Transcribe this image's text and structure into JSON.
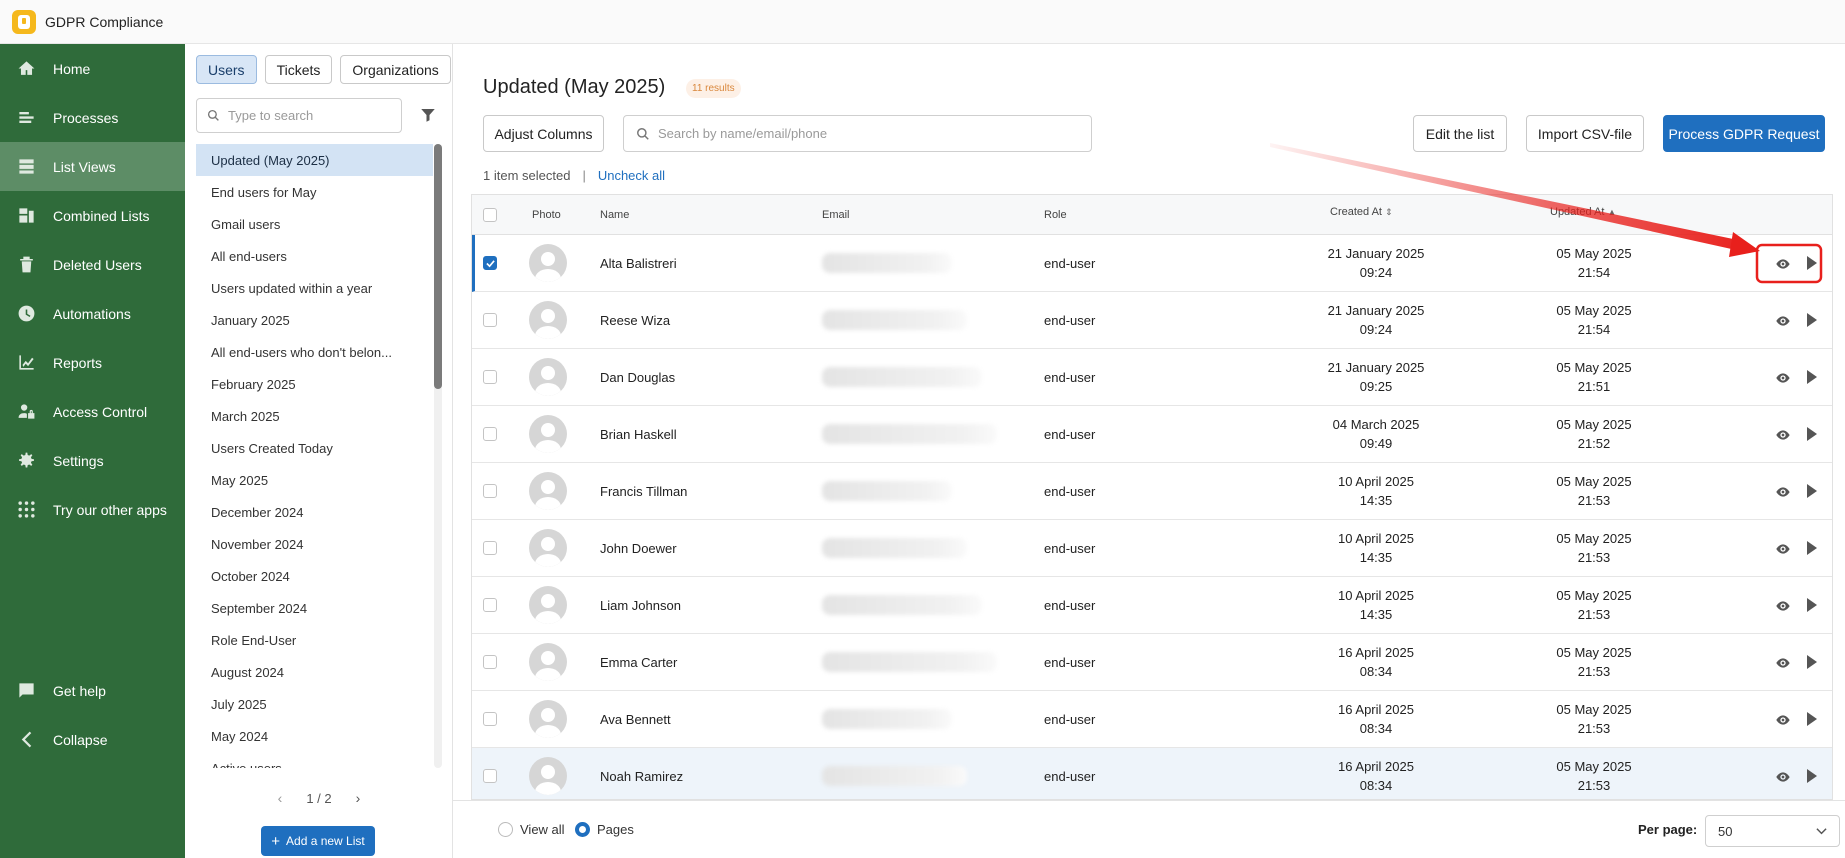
{
  "app": {
    "title": "GDPR Compliance"
  },
  "sidebar": {
    "items": [
      {
        "label": "Home",
        "icon": "home-icon"
      },
      {
        "label": "Processes",
        "icon": "processes-icon"
      },
      {
        "label": "List Views",
        "icon": "list-views-icon",
        "active": true
      },
      {
        "label": "Combined Lists",
        "icon": "combined-lists-icon"
      },
      {
        "label": "Deleted Users",
        "icon": "deleted-users-icon"
      },
      {
        "label": "Automations",
        "icon": "clock-icon"
      },
      {
        "label": "Reports",
        "icon": "chart-icon"
      },
      {
        "label": "Access Control",
        "icon": "user-lock-icon"
      },
      {
        "label": "Settings",
        "icon": "gear-icon"
      },
      {
        "label": "Try our other apps",
        "icon": "grid-icon"
      }
    ],
    "bottom": [
      {
        "label": "Get help",
        "icon": "chat-icon"
      },
      {
        "label": "Collapse",
        "icon": "chevron-left-icon"
      }
    ]
  },
  "listpanel": {
    "tabs": [
      "Users",
      "Tickets",
      "Organizations"
    ],
    "search_placeholder": "Type to search",
    "lists": [
      "Updated (May 2025)",
      "End users for May",
      "Gmail users",
      "All end-users",
      "Users updated within a year",
      "January 2025",
      "All end-users who don't belon...",
      "February 2025",
      "March 2025",
      "Users Created Today",
      "May 2025",
      "December 2024",
      "November 2024",
      "October 2024",
      "September 2024",
      "Role End-User",
      "August 2024",
      "July 2025",
      "May 2024",
      "Active users"
    ],
    "pagination": "1 / 2",
    "add_button": "Add a new List"
  },
  "main": {
    "title": "Updated (May 2025)",
    "count": "11 results",
    "adjust_columns": "Adjust Columns",
    "search_placeholder": "Search by name/email/phone",
    "edit_list": "Edit the list",
    "import_csv": "Import CSV-file",
    "process_gdpr": "Process GDPR Request",
    "selection_text": "1 item selected",
    "separator": "|",
    "uncheck_all": "Uncheck all",
    "columns": {
      "photo": "Photo",
      "name": "Name",
      "email": "Email",
      "role": "Role",
      "created": "Created At",
      "updated": "Updated At"
    },
    "rows": [
      {
        "name": "Alta Balistreri",
        "role": "end-user",
        "created_date": "21 January 2025",
        "created_time": "09:24",
        "updated_date": "05 May 2025",
        "updated_time": "21:54",
        "checked": true
      },
      {
        "name": "Reese Wiza",
        "role": "end-user",
        "created_date": "21 January 2025",
        "created_time": "09:24",
        "updated_date": "05 May 2025",
        "updated_time": "21:54"
      },
      {
        "name": "Dan Douglas",
        "role": "end-user",
        "created_date": "21 January 2025",
        "created_time": "09:25",
        "updated_date": "05 May 2025",
        "updated_time": "21:51"
      },
      {
        "name": "Brian Haskell",
        "role": "end-user",
        "created_date": "04 March 2025",
        "created_time": "09:49",
        "updated_date": "05 May 2025",
        "updated_time": "21:52"
      },
      {
        "name": "Francis Tillman",
        "role": "end-user",
        "created_date": "10 April 2025",
        "created_time": "14:35",
        "updated_date": "05 May 2025",
        "updated_time": "21:53"
      },
      {
        "name": "John Doewer",
        "role": "end-user",
        "created_date": "10 April 2025",
        "created_time": "14:35",
        "updated_date": "05 May 2025",
        "updated_time": "21:53"
      },
      {
        "name": "Liam Johnson",
        "role": "end-user",
        "created_date": "10 April 2025",
        "created_time": "14:35",
        "updated_date": "05 May 2025",
        "updated_time": "21:53"
      },
      {
        "name": "Emma Carter",
        "role": "end-user",
        "created_date": "16 April 2025",
        "created_time": "08:34",
        "updated_date": "05 May 2025",
        "updated_time": "21:53"
      },
      {
        "name": "Ava Bennett",
        "role": "end-user",
        "created_date": "16 April 2025",
        "created_time": "08:34",
        "updated_date": "05 May 2025",
        "updated_time": "21:53"
      },
      {
        "name": "Noah Ramirez",
        "role": "end-user",
        "created_date": "16 April 2025",
        "created_time": "08:34",
        "updated_date": "05 May 2025",
        "updated_time": "21:53"
      }
    ],
    "view_all": "View all",
    "pages": "Pages",
    "per_page_label": "Per page:",
    "per_page_value": "50"
  },
  "colors": {
    "sidebar_bg": "#2f6b3a",
    "sidebar_active": "#5d8d66",
    "primary": "#1f6fbf",
    "annotation": "#e8201c"
  }
}
